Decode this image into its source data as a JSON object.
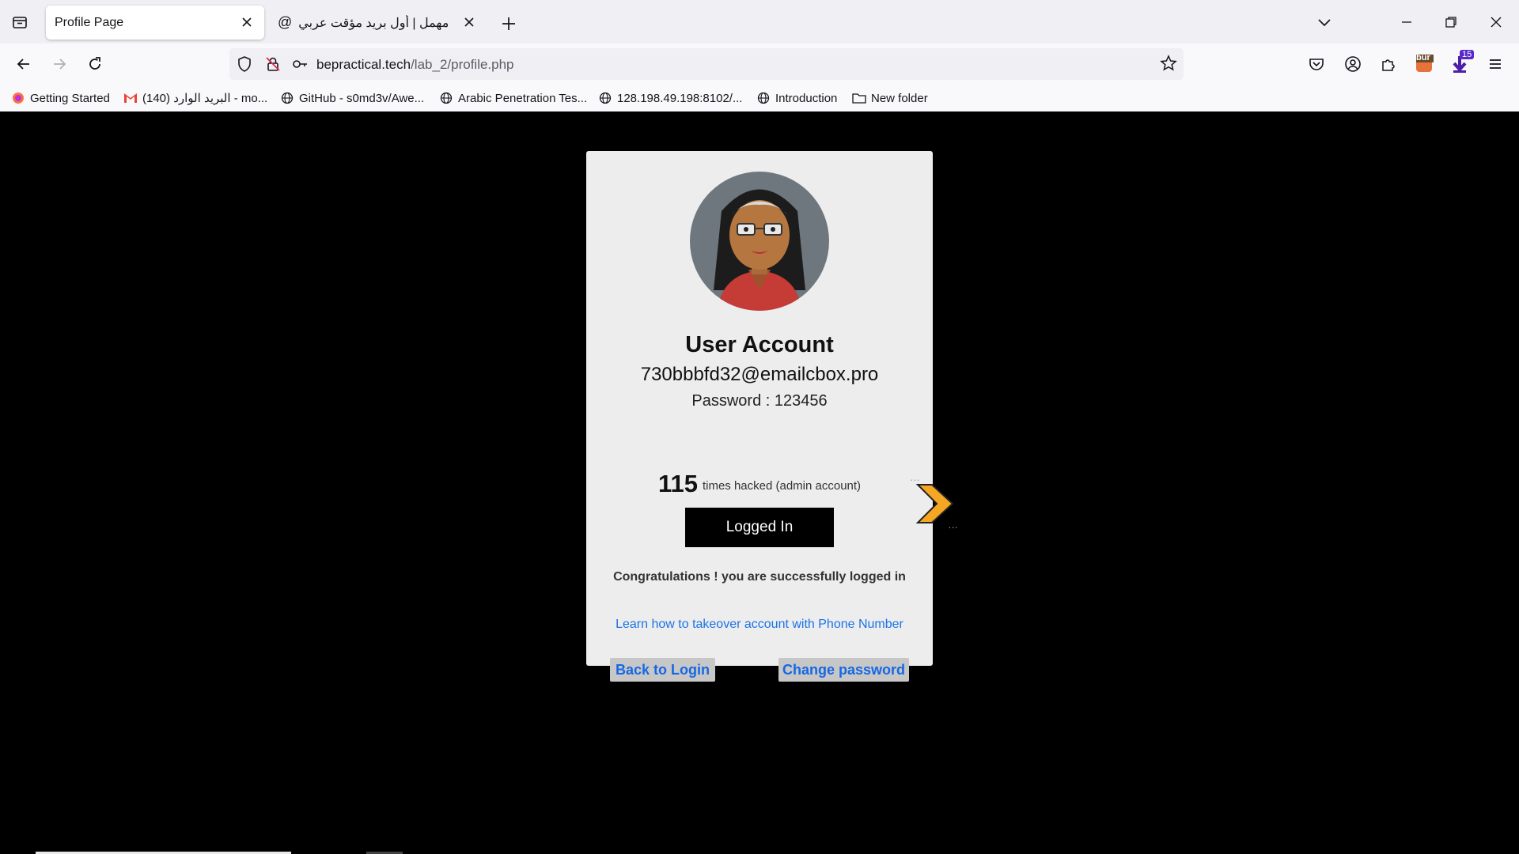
{
  "tabs": [
    {
      "title": "Profile Page",
      "active": true
    },
    {
      "title": "مهمل | أول بريد مؤقت عربي",
      "active": false
    }
  ],
  "url": {
    "host": "bepractical.tech",
    "path": "/lab_2/profile.php"
  },
  "bookmarks": [
    {
      "label": "Getting Started",
      "icon": "firefox-icon"
    },
    {
      "label": "البريد الوارد (140) - mo...",
      "icon": "gmail-icon"
    },
    {
      "label": "GitHub - s0md3v/Awe...",
      "icon": "globe-icon"
    },
    {
      "label": "Arabic Penetration Tes...",
      "icon": "globe-icon"
    },
    {
      "label": "128.198.49.198:8102/...",
      "icon": "globe-icon"
    },
    {
      "label": "Introduction",
      "icon": "globe-icon"
    },
    {
      "label": "New folder",
      "icon": "folder-icon"
    }
  ],
  "extensions": {
    "badge_count": "15",
    "burp_label": "bur"
  },
  "profile": {
    "title": "User Account",
    "email": "730bbbfd32@emailcbox.pro",
    "password_line": "Password : 123456",
    "hack_count": "115",
    "hack_text": "times hacked (admin account)",
    "status_button": "Logged In",
    "message": "Congratulations ! you are successfully logged in",
    "learn_link": "Learn how to takeover account with Phone Number",
    "back_button": "Back to Login",
    "change_button": "Change password"
  },
  "colors": {
    "link": "#1a73e8",
    "card_bg": "#ededed",
    "page_bg": "#000000",
    "arrow": "#f5a623"
  }
}
